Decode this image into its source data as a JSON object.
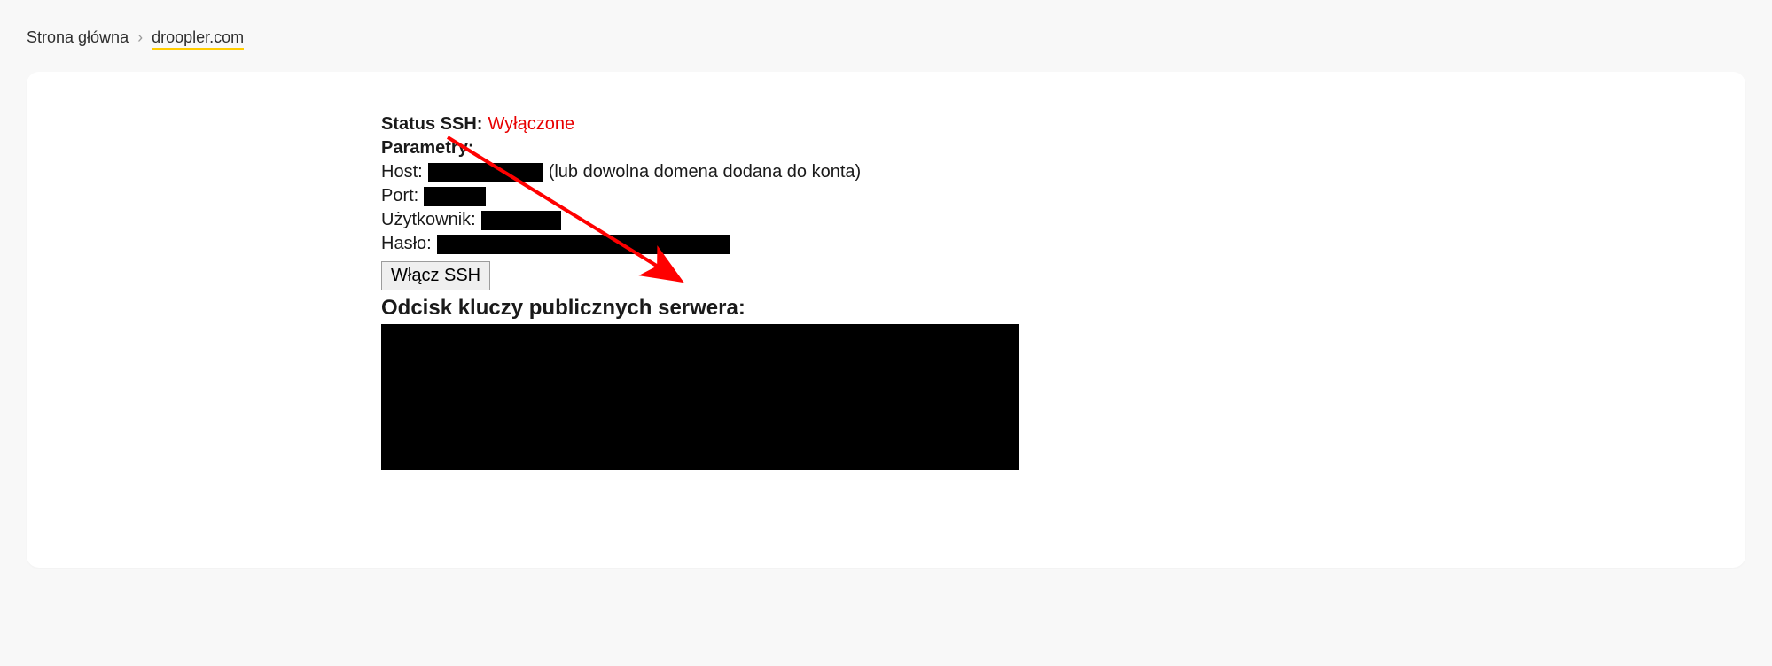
{
  "breadcrumb": {
    "home": "Strona główna",
    "separator": "›",
    "current": "droopler.com"
  },
  "ssh": {
    "status_label": "Status SSH:",
    "status_value": "Wyłączone",
    "params_label": "Parametry:",
    "host_label": "Host:",
    "host_note": "(lub dowolna domena dodana do konta)",
    "port_label": "Port:",
    "user_label": "Użytkownik:",
    "password_label": "Hasło:",
    "enable_button": "Włącz SSH",
    "fingerprint_heading": "Odcisk kluczy publicznych serwera:"
  }
}
